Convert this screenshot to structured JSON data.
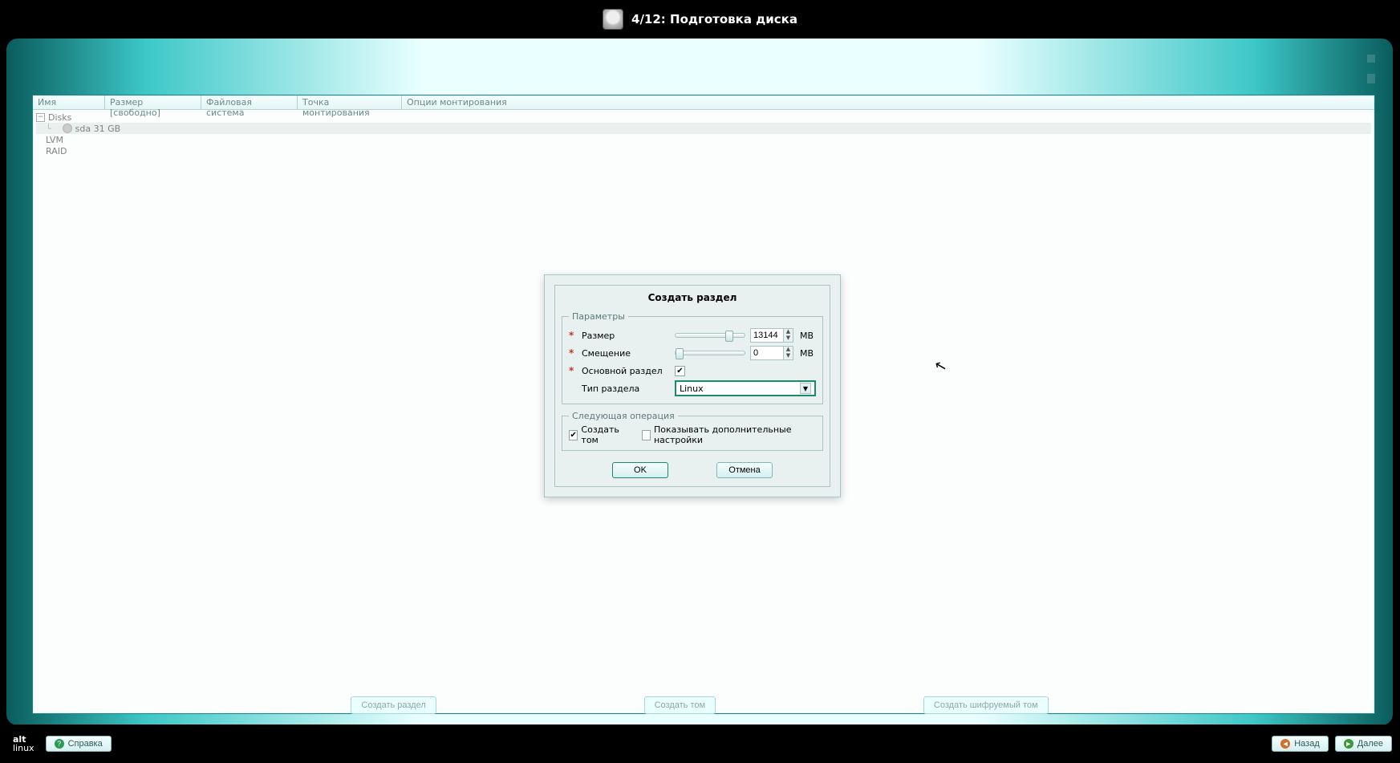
{
  "header": {
    "title": "4/12: Подготовка диска"
  },
  "columns": {
    "name": "Имя",
    "size": "Размер [свободно]",
    "fs": "Файловая система",
    "mount": "Точка монтирования",
    "opts": "Опции монтирования"
  },
  "tree": {
    "disks_label": "Disks",
    "sda": "sda  31 GB",
    "lvm": "LVM",
    "raid": "RAID"
  },
  "actions": {
    "create_partition": "Создать раздел",
    "create_volume": "Создать том",
    "create_encrypted": "Создать шифруемый том"
  },
  "footer": {
    "logo_top": "alt",
    "logo_bottom": "linux",
    "help": "Справка",
    "back": "Назад",
    "next": "Далее"
  },
  "dialog": {
    "title": "Создать раздел",
    "params_legend": "Параметры",
    "size_label": "Размер",
    "size_value": "13144",
    "offset_label": "Смещение",
    "offset_value": "0",
    "unit": "MB",
    "primary_label": "Основной раздел",
    "type_label": "Тип раздела",
    "type_value": "Linux",
    "next_legend": "Следующая операция",
    "create_vol": "Создать том",
    "show_adv": "Показывать дополнительные настройки",
    "ok": "OK",
    "cancel": "Отмена"
  }
}
